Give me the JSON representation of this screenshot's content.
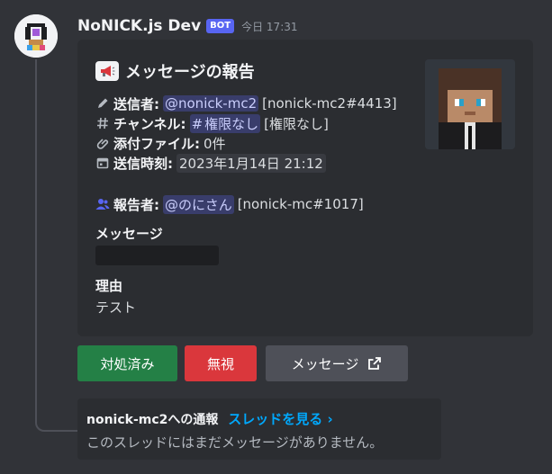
{
  "message": {
    "username": "NoNICK.js Dev",
    "bot_tag": "BOT",
    "timestamp": "今日 17:31"
  },
  "embed": {
    "title": "メッセージの報告",
    "sender": {
      "label": "送信者:",
      "mention": "@nonick-mc2",
      "tag": "[nonick-mc2#4413]"
    },
    "channel": {
      "label": "チャンネル:",
      "mention": "権限なし",
      "name": "[権限なし]"
    },
    "attachments": {
      "label": "添付ファイル:",
      "value": "0件"
    },
    "sent_time": {
      "label": "送信時刻:",
      "value": "2023年1月14日 21:12"
    },
    "reporter": {
      "label": "報告者:",
      "mention": "@のにさん",
      "tag": "[nonick-mc#1017]"
    },
    "message_section": {
      "title": "メッセージ"
    },
    "reason_section": {
      "title": "理由",
      "value": "テスト"
    }
  },
  "buttons": {
    "handled": "対処済み",
    "ignore": "無視",
    "message": "メッセージ"
  },
  "thread": {
    "title": "nonick-mc2への通報",
    "link": "スレッドを見る ›",
    "empty": "このスレッドにはまだメッセージがありません。"
  },
  "colors": {
    "background": "#313338",
    "embed": "#2b2d31",
    "blurple": "#5865f2",
    "green": "#248046",
    "red": "#da373c",
    "grey": "#4e5058",
    "link": "#00a8fc"
  },
  "icons": [
    "megaphone-icon",
    "pencil-icon",
    "hash-icon",
    "paperclip-icon",
    "calendar-icon",
    "user-icon",
    "external-link-icon"
  ]
}
